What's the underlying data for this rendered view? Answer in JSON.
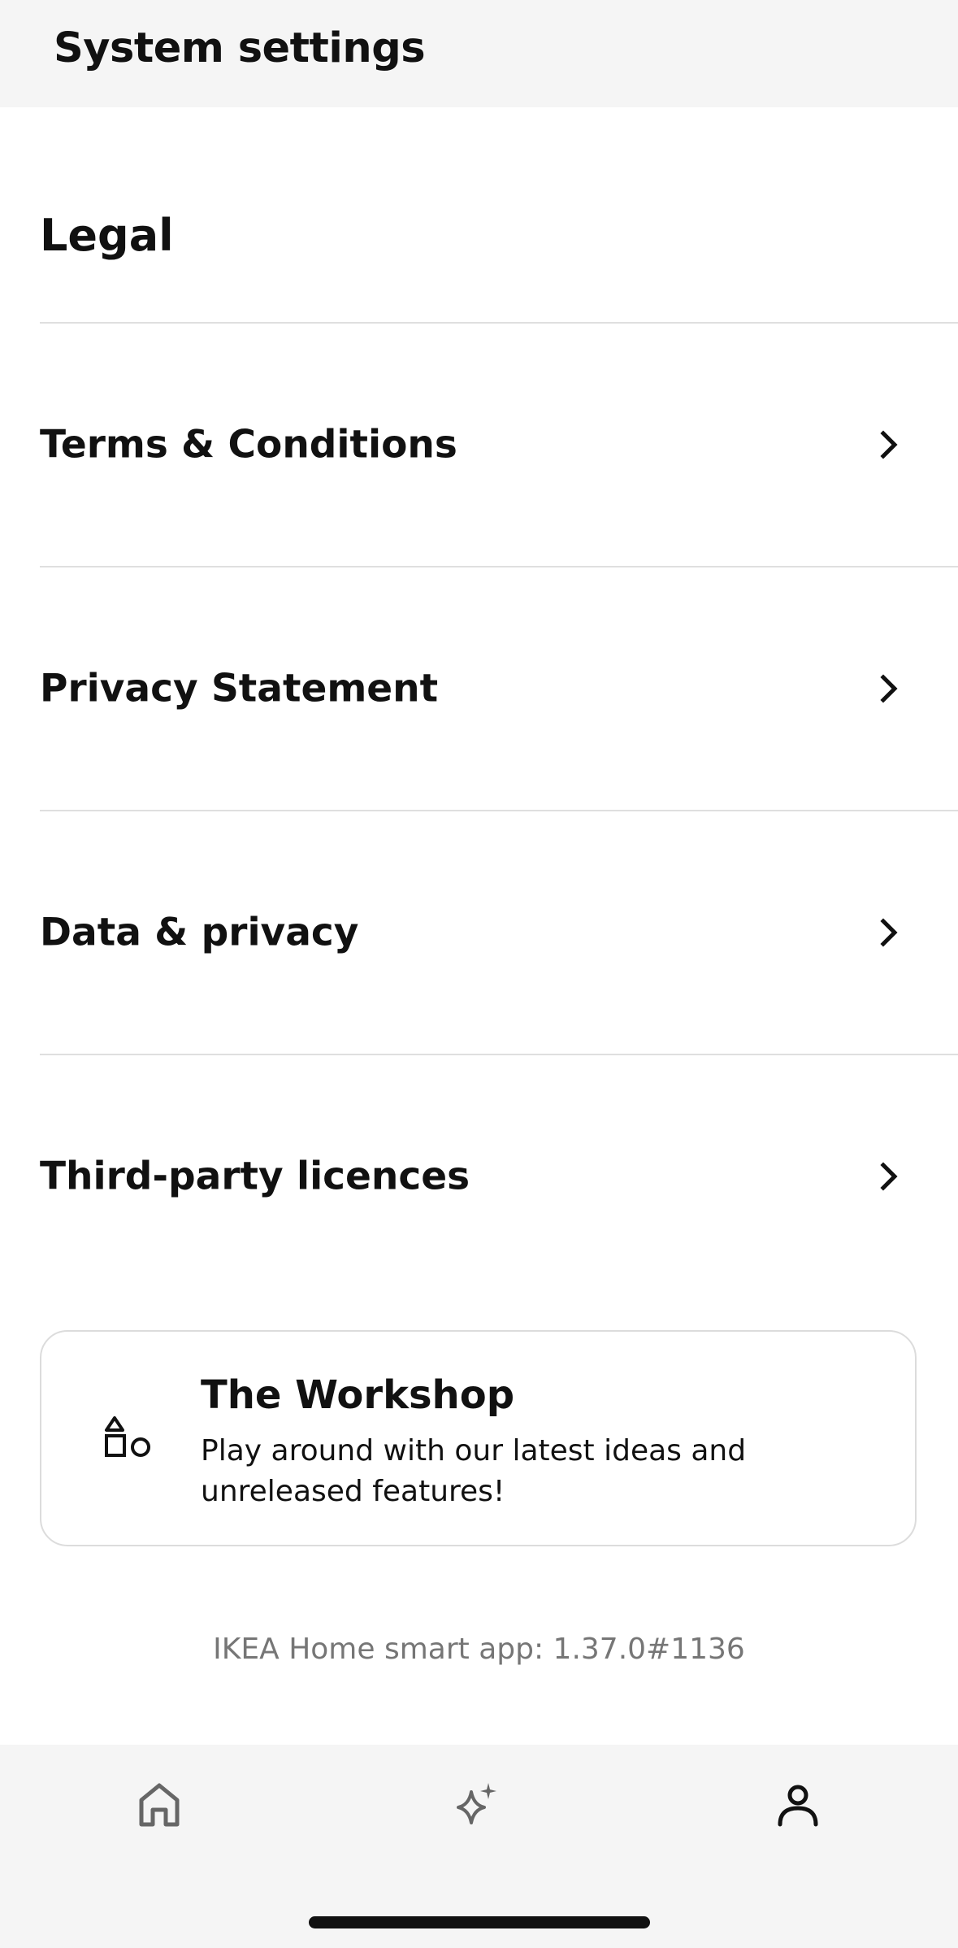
{
  "header": {
    "title": "System settings"
  },
  "section": {
    "heading": "Legal"
  },
  "rows": [
    {
      "label": "Terms & Conditions",
      "icon": "chevron-right-icon"
    },
    {
      "label": "Privacy Statement",
      "icon": "chevron-right-icon"
    },
    {
      "label": "Data & privacy",
      "icon": "chevron-right-icon"
    },
    {
      "label": "Third-party licences",
      "icon": "chevron-right-icon"
    }
  ],
  "workshop_card": {
    "icon": "shapes-icon",
    "title": "The Workshop",
    "description": "Play around with our latest ideas and unreleased features!"
  },
  "version_text": "IKEA Home smart app: 1.37.0#1136",
  "tabbar": {
    "tabs": [
      {
        "icon": "home-icon",
        "active": false
      },
      {
        "icon": "sparkle-icon",
        "active": false
      },
      {
        "icon": "profile-icon",
        "active": true
      }
    ]
  },
  "colors": {
    "text": "#111111",
    "muted_text": "#767676",
    "divider": "#dfdfdf",
    "bar_background": "#f5f5f5",
    "inactive_tab_icon": "#666666"
  }
}
